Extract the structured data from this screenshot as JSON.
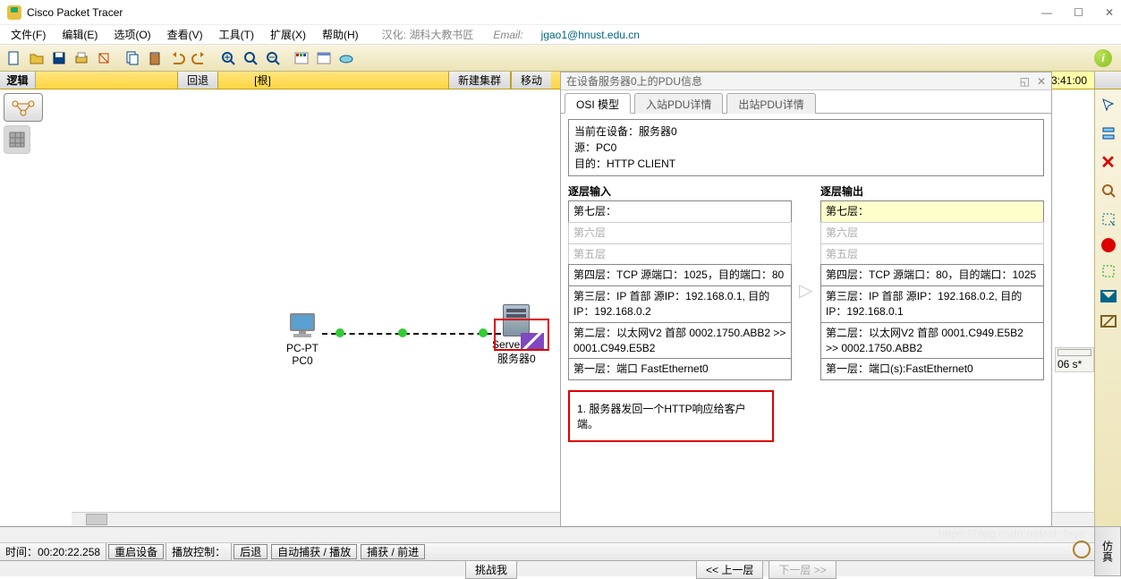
{
  "app": {
    "title": "Cisco Packet Tracer"
  },
  "menu": {
    "items": [
      "文件(F)",
      "编辑(E)",
      "选项(O)",
      "查看(V)",
      "工具(T)",
      "扩展(X)",
      "帮助(H)"
    ],
    "translation": "汉化: 湖科大教书匠",
    "email_label": "Email:",
    "email": "jgao1@hnust.edu.cn"
  },
  "subbar": {
    "logic": "逻辑",
    "back": "回退",
    "root": "[根]",
    "newcluster": "新建集群",
    "move": "移动",
    "clock": "3:41:00"
  },
  "devices": {
    "pc": {
      "line1": "PC-PT",
      "line2": "PC0"
    },
    "server": {
      "line1": "Server-PT",
      "line2": "服务器0"
    }
  },
  "pdu": {
    "title": "在设备服务器0上的PDU信息",
    "tabs": {
      "osi": "OSI 模型",
      "in": "入站PDU详情",
      "out": "出站PDU详情"
    },
    "info": {
      "at_label": "当前在设备：",
      "at": "服务器0",
      "src_label": "源：",
      "src": "PC0",
      "dst_label": "目的：",
      "dst": "HTTP CLIENT"
    },
    "in_title": "逐层输入",
    "out_title": "逐层输出",
    "layers_in": {
      "l7": "第七层：",
      "l6": "第六层",
      "l5": "第五层",
      "l4": "第四层：TCP 源端口：1025，目的端口：80",
      "l3": "第三层：IP 首部 源IP：192.168.0.1, 目的IP：192.168.0.2",
      "l2": "第二层：以太网V2 首部 0002.1750.ABB2 >> 0001.C949.E5B2",
      "l1": "第一层：端口 FastEthernet0"
    },
    "layers_out": {
      "l7": "第七层：",
      "l6": "第六层",
      "l5": "第五层",
      "l4": "第四层：TCP 源端口：80，目的端口：1025",
      "l3": "第三层：IP 首部 源IP：192.168.0.2, 目的IP：192.168.0.1",
      "l2": "第二层：以太网V2 首部 0001.C949.E5B2 >> 0002.1750.ABB2",
      "l1": "第一层：端口(s):FastEthernet0"
    },
    "note": "1. 服务器发回一个HTTP响应给客户端。",
    "challenge": "挑战我",
    "prev": "<< 上一层",
    "next": "下一层 >>"
  },
  "bottom": {
    "time_label": "时间：",
    "time": "00:20:22.258",
    "reset": "重启设备",
    "playctrl": "播放控制：",
    "back": "后退",
    "auto": "自动捕获 / 播放",
    "fwd": "捕获 / 前进",
    "ctx": "06 s*"
  },
  "sim_tab": "仿真"
}
